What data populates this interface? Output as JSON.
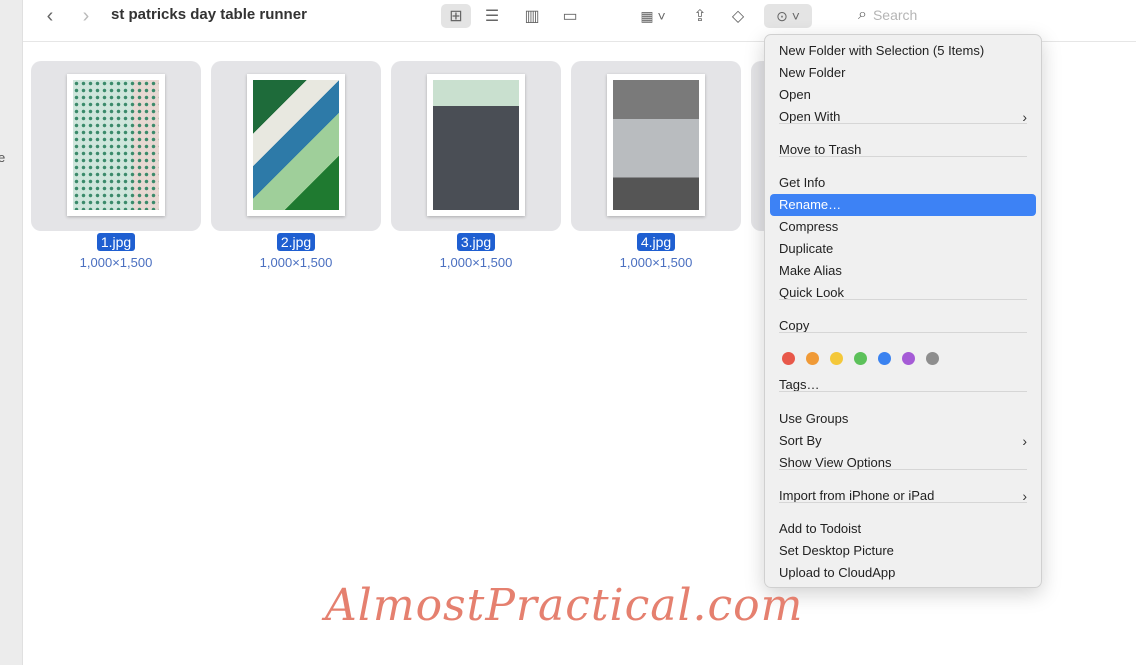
{
  "sidebar": {
    "partial_text": "e"
  },
  "toolbar": {
    "title": "st patricks day table runner",
    "search_placeholder": "Search",
    "icons": [
      "chevron-left-icon",
      "chevron-right-icon",
      "icon-view-icon",
      "list-view-icon",
      "column-view-icon",
      "gallery-view-icon",
      "group-icon",
      "share-icon",
      "tag-icon",
      "more-actions-icon",
      "search-icon"
    ]
  },
  "files": [
    {
      "name": "1.jpg",
      "dims": "1,000×1,500"
    },
    {
      "name": "2.jpg",
      "dims": "1,000×1,500"
    },
    {
      "name": "3.jpg",
      "dims": "1,000×1,500"
    },
    {
      "name": "4.jpg",
      "dims": "1,000×1,500"
    }
  ],
  "menu": {
    "items": [
      {
        "label": "New Folder with Selection (5 Items)"
      },
      {
        "label": "New Folder"
      },
      {
        "label": "Open"
      },
      {
        "label": "Open With",
        "submenu": true
      },
      {
        "label": "Move to Trash"
      },
      {
        "label": "Get Info"
      },
      {
        "label": "Rename…",
        "highlighted": true
      },
      {
        "label": "Compress"
      },
      {
        "label": "Duplicate"
      },
      {
        "label": "Make Alias"
      },
      {
        "label": "Quick Look"
      },
      {
        "label": "Copy"
      },
      {
        "label": "Tags…"
      },
      {
        "label": "Use Groups"
      },
      {
        "label": "Sort By",
        "submenu": true
      },
      {
        "label": "Show View Options"
      },
      {
        "label": "Import from iPhone or iPad",
        "submenu": true
      },
      {
        "label": "Add to Todoist"
      },
      {
        "label": "Set Desktop Picture"
      },
      {
        "label": "Upload to CloudApp"
      }
    ],
    "tag_colors": [
      "#e8584a",
      "#f09a37",
      "#f4c83a",
      "#5cc15a",
      "#3a82f0",
      "#a55bd6",
      "#8e8e8e"
    ],
    "highlight_color": "#3d82f5"
  },
  "watermark": "AlmostPractical.com"
}
